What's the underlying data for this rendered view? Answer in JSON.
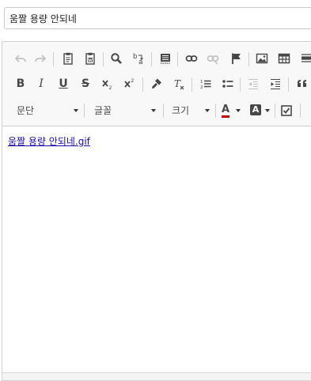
{
  "title_field": {
    "value": "움짤 용량 안되네"
  },
  "toolbar": {
    "undo": "undo",
    "redo": "redo",
    "paste_text": "paste-text",
    "paste_word": "paste-from-word",
    "find": "find",
    "replace": "replace",
    "select_all": "select-all",
    "link": "link",
    "unlink": "unlink",
    "anchor": "anchor",
    "image": "image",
    "table": "table",
    "hr": "horizontal-line",
    "bold_label": "B",
    "italic_label": "I",
    "underline_label": "U",
    "strike_label": "S",
    "subscript": "subscript",
    "superscript": "superscript",
    "copy_format": "copy-formatting",
    "remove_format": "remove-format",
    "numbered_list": "numbered-list",
    "bulleted_list": "bulleted-list",
    "outdent": "outdent",
    "indent": "indent",
    "blockquote": "blockquote",
    "format_label": "문단",
    "font_label": "글꼴",
    "size_label": "크기",
    "text_color_label": "A",
    "bg_color_label": "A",
    "text_color": "#c00000",
    "checkbox": "checkbox"
  },
  "content": {
    "link_text": "움짤 용량 안되네.gif"
  }
}
